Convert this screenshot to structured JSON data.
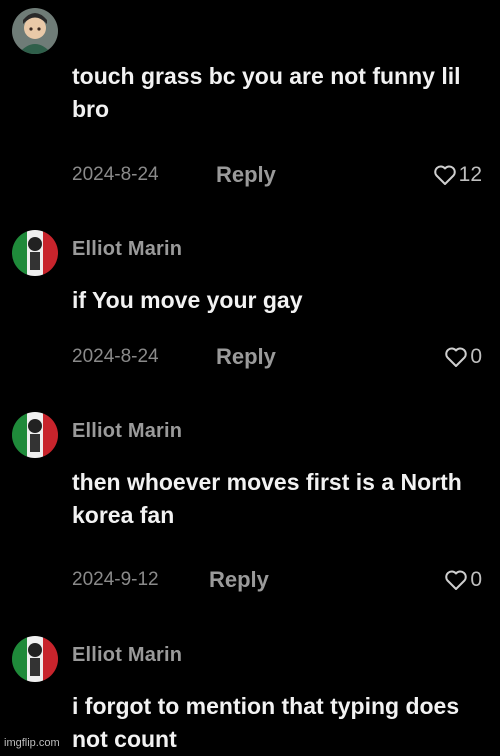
{
  "comments": [
    {
      "username": "",
      "text": "touch grass bc you are not funny lil bro",
      "date": "2024-8-24",
      "reply_label": "Reply",
      "likes": "12",
      "avatar_icon": "profile-avatar-icon"
    },
    {
      "username": "Elliot Marin",
      "text": "if You move your gay",
      "date": "2024-8-24",
      "reply_label": "Reply",
      "likes": "0",
      "avatar_icon": "profile-avatar-icon"
    },
    {
      "username": "Elliot Marin",
      "text": "then whoever moves first is a North korea fan",
      "date": "2024-9-12",
      "reply_label": "Reply",
      "likes": "0",
      "avatar_icon": "profile-avatar-icon"
    },
    {
      "username": "Elliot Marin",
      "text": "i forgot to mention that typing does not count",
      "date": "",
      "reply_label": "",
      "likes": "",
      "avatar_icon": "profile-avatar-icon"
    }
  ],
  "watermark": "imgflip.com",
  "colors": {
    "background": "#000000",
    "text": "#f2f2f2",
    "muted": "#8a8a8a"
  },
  "like_icon": "heart-outline-icon"
}
